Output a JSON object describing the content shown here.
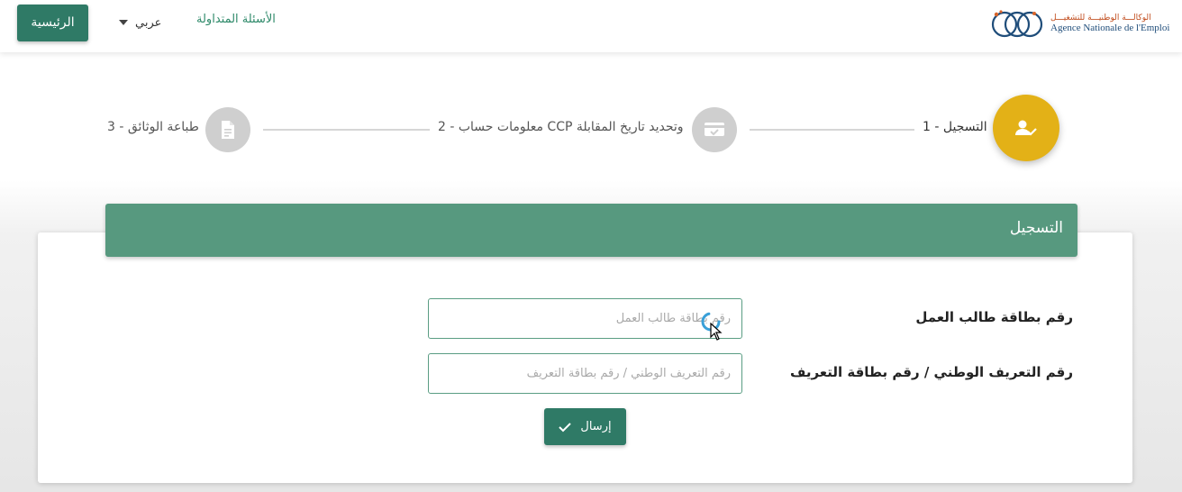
{
  "header": {
    "home_label": "الرئيسية",
    "language": {
      "selected": "عربي",
      "icon": "chevron-down-icon"
    },
    "faq_label": "الأسئلة المتداولة",
    "logo": {
      "text_ar": "الوكالـــة الوطنيـــة للتشغيـــل",
      "text_fr": "Agence Nationale de l'Emploi"
    }
  },
  "stepper": {
    "steps": [
      {
        "number": "1",
        "label": "1 - التسجيل",
        "status": "active",
        "icon": "user-check-icon"
      },
      {
        "number": "2",
        "label": "2 - معلومات حساب CCP وتحديد تاريخ المقابلة",
        "status": "pending",
        "icon": "credit-card-check-icon"
      },
      {
        "number": "3",
        "label": "3 - طباعة الوثائق",
        "status": "pending",
        "icon": "document-icon"
      }
    ]
  },
  "form": {
    "title": "التسجيل",
    "fields": [
      {
        "label": "رقم بطاقة طالب العمل",
        "value": "",
        "placeholder": "رقم بطاقة طالب العمل"
      },
      {
        "label": "رقم التعريف الوطني / رقم بطاقة التعريف",
        "value": "",
        "placeholder": "رقم التعريف الوطني / رقم بطاقة التعريف"
      }
    ],
    "submit_label": "إرسال",
    "submit_icon": "check-icon"
  },
  "colors": {
    "primary": "#2f7a66",
    "header_band": "#57997f",
    "active_step": "#e3b117",
    "inactive_step": "#cfcfcf",
    "link": "#2f8a6a"
  }
}
